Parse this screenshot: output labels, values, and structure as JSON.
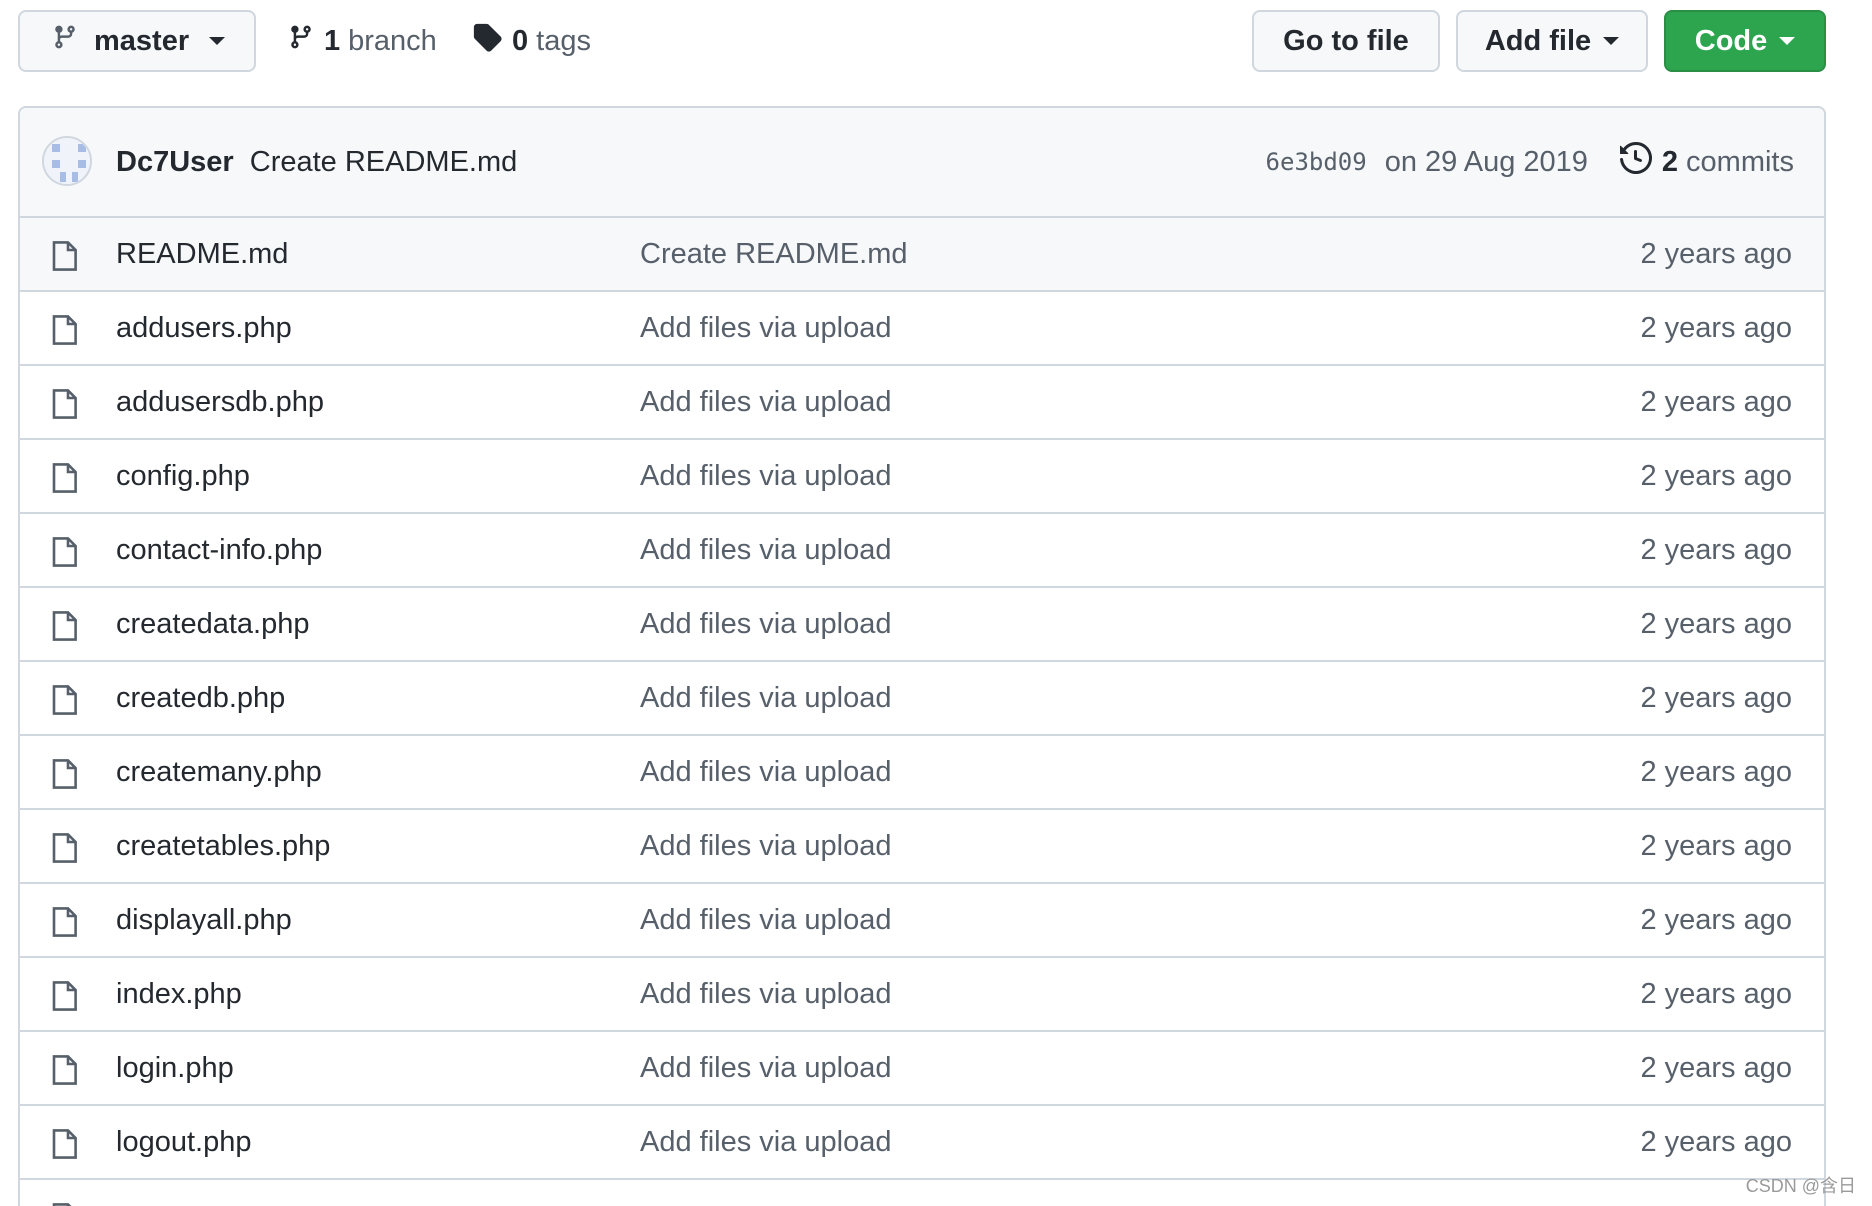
{
  "toolbar": {
    "branch_selector": {
      "label": "master",
      "icon": "git-branch-icon"
    },
    "branches": {
      "count": "1",
      "label": "branch"
    },
    "tags": {
      "count": "0",
      "label": "tags"
    },
    "go_to_file_label": "Go to file",
    "add_file_label": "Add file",
    "code_label": "Code",
    "code_button_color": "#2da44e"
  },
  "latest_commit": {
    "author": "Dc7User",
    "message": "Create README.md",
    "sha": "6e3bd09",
    "date": "on 29 Aug 2019",
    "commits_count": "2",
    "commits_label": "commits"
  },
  "files": [
    {
      "name": "README.md",
      "commit_message": "Create README.md",
      "age": "2 years ago"
    },
    {
      "name": "addusers.php",
      "commit_message": "Add files via upload",
      "age": "2 years ago"
    },
    {
      "name": "addusersdb.php",
      "commit_message": "Add files via upload",
      "age": "2 years ago"
    },
    {
      "name": "config.php",
      "commit_message": "Add files via upload",
      "age": "2 years ago"
    },
    {
      "name": "contact-info.php",
      "commit_message": "Add files via upload",
      "age": "2 years ago"
    },
    {
      "name": "createdata.php",
      "commit_message": "Add files via upload",
      "age": "2 years ago"
    },
    {
      "name": "createdb.php",
      "commit_message": "Add files via upload",
      "age": "2 years ago"
    },
    {
      "name": "createmany.php",
      "commit_message": "Add files via upload",
      "age": "2 years ago"
    },
    {
      "name": "createtables.php",
      "commit_message": "Add files via upload",
      "age": "2 years ago"
    },
    {
      "name": "displayall.php",
      "commit_message": "Add files via upload",
      "age": "2 years ago"
    },
    {
      "name": "index.php",
      "commit_message": "Add files via upload",
      "age": "2 years ago"
    },
    {
      "name": "login.php",
      "commit_message": "Add files via upload",
      "age": "2 years ago"
    },
    {
      "name": "logout.php",
      "commit_message": "Add files via upload",
      "age": "2 years ago"
    },
    {
      "name": "",
      "commit_message": "",
      "age": ""
    }
  ],
  "watermark": "CSDN @含日"
}
